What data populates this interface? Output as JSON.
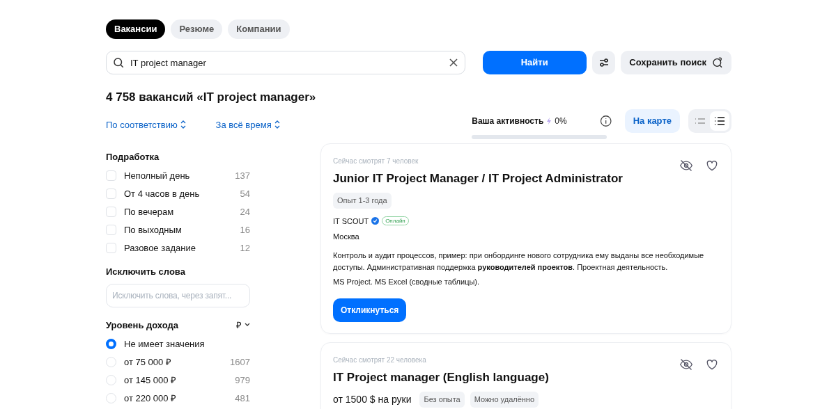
{
  "tabs": [
    {
      "label": "Вакансии",
      "selected": true
    },
    {
      "label": "Резюме",
      "selected": false
    },
    {
      "label": "Компании",
      "selected": false
    }
  ],
  "search": {
    "value": "IT project manager",
    "button": "Найти",
    "save": "Сохранить поиск"
  },
  "heading": "4 758 вакансий «IT project manager»",
  "sorts": [
    "По соответствию",
    "За всё время"
  ],
  "activity": {
    "label": "Ваша активность",
    "reading": "0%",
    "level": 0
  },
  "map_button": "На карте",
  "view_toggle": [
    {
      "kind": "compact",
      "selected": false
    },
    {
      "kind": "detailed",
      "selected": true
    }
  ],
  "filters": {
    "parttime": {
      "title": "Подработка",
      "items": [
        {
          "label": "Неполный день",
          "count": "137",
          "checked": false
        },
        {
          "label": "От 4 часов в день",
          "count": "54",
          "checked": false
        },
        {
          "label": "По вечерам",
          "count": "24",
          "checked": false
        },
        {
          "label": "По выходным",
          "count": "16",
          "checked": false
        },
        {
          "label": "Разовое задание",
          "count": "12",
          "checked": false
        }
      ]
    },
    "exclude": {
      "title": "Исключить слова",
      "placeholder": "Исключить слова, через запят..."
    },
    "income": {
      "title": "Уровень дохода",
      "currency": "₽",
      "items": [
        {
          "label": "Не имеет значения",
          "selected": true
        },
        {
          "label": "от 75 000 ₽",
          "count": "1607",
          "selected": false
        },
        {
          "label": "от 145 000 ₽",
          "count": "979",
          "selected": false
        },
        {
          "label": "от 220 000 ₽",
          "count": "481",
          "selected": false
        }
      ]
    }
  },
  "vacancies": [
    {
      "viewers": "Сейчас смотрят 7 человек",
      "title": "Junior IT Project Manager / IT Project Administrator",
      "tags": [
        "Опыт 1-3 года"
      ],
      "company": "IT SCOUT",
      "verified": true,
      "online": "Онлайн",
      "city": "Москва",
      "description": [
        "Контроль и аудит процессов, пример: при онбординге нового сотрудника ему выданы все необходимые доступы. Административная поддержка **руководителей проектов**. Проектная деятельность.",
        "MS Project. MS Excel (сводные таблицы)."
      ],
      "apply": "Откликнуться"
    },
    {
      "viewers": "Сейчас смотрят 22 человека",
      "title": "IT Project manager (English language)",
      "salary": "от 1500 $ на руки",
      "tags": [
        "Без опыта",
        "Можно удалённо"
      ]
    }
  ]
}
